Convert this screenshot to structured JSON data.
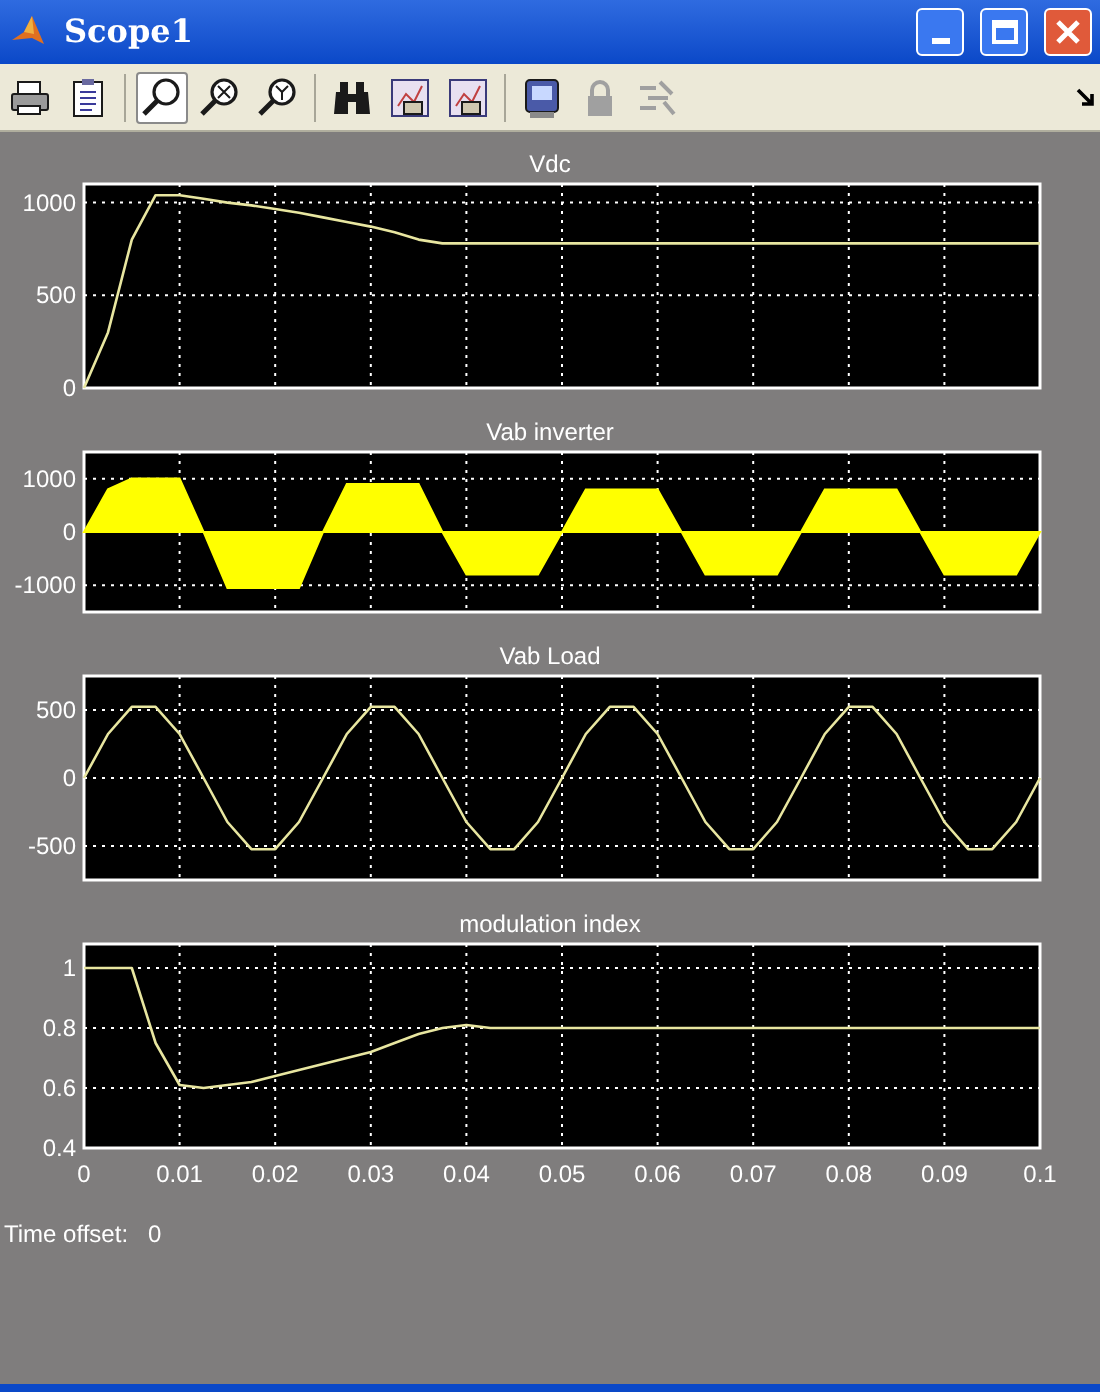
{
  "window": {
    "title": "Scope1"
  },
  "toolbar": [
    {
      "kind": "print",
      "selected": false,
      "disabled": false
    },
    {
      "kind": "parameters",
      "selected": false,
      "disabled": false
    },
    {
      "kind": "zoom",
      "selected": true,
      "disabled": false
    },
    {
      "kind": "zoom-x",
      "selected": false,
      "disabled": false
    },
    {
      "kind": "zoom-y",
      "selected": false,
      "disabled": false
    },
    {
      "kind": "autoscale",
      "selected": false,
      "disabled": false
    },
    {
      "kind": "save-axes",
      "selected": false,
      "disabled": false
    },
    {
      "kind": "restore-axes",
      "selected": false,
      "disabled": false
    },
    {
      "kind": "floating",
      "selected": false,
      "disabled": false
    },
    {
      "kind": "lock",
      "selected": false,
      "disabled": true
    },
    {
      "kind": "signal-select",
      "selected": false,
      "disabled": true
    }
  ],
  "plots": [
    {
      "chart_data": {
        "type": "line",
        "title": "Vdc",
        "grid": true,
        "xlim": [
          0,
          0.1
        ],
        "ylim": [
          0,
          1100
        ],
        "yticks": [
          0,
          500,
          1000
        ],
        "x": [
          0,
          0.0025,
          0.005,
          0.0075,
          0.01,
          0.0125,
          0.015,
          0.0175,
          0.02,
          0.0225,
          0.025,
          0.0275,
          0.03,
          0.0325,
          0.035,
          0.0375,
          0.04,
          0.0425,
          0.045,
          0.0475,
          0.05,
          0.0525,
          0.055,
          0.0575,
          0.06,
          0.0625,
          0.065,
          0.0675,
          0.07,
          0.0725,
          0.075,
          0.0775,
          0.08,
          0.0825,
          0.085,
          0.0875,
          0.09,
          0.0925,
          0.095,
          0.0975,
          0.1
        ],
        "series": [
          {
            "color": "#e8e6a0",
            "values": [
              0,
              300,
              800,
              1040,
              1040,
              1020,
              1000,
              985,
              965,
              945,
              920,
              895,
              870,
              840,
              800,
              780,
              780,
              780,
              780,
              780,
              780,
              780,
              780,
              780,
              780,
              780,
              780,
              780,
              780,
              780,
              780,
              780,
              780,
              780,
              780,
              780,
              780,
              780,
              780,
              780,
              780
            ]
          }
        ]
      }
    },
    {
      "chart_data": {
        "type": "area",
        "title": "Vab inverter",
        "grid": true,
        "xlim": [
          0,
          0.1
        ],
        "ylim": [
          -1500,
          1500
        ],
        "yticks": [
          -1000,
          0,
          1000
        ],
        "x": [
          0,
          0.0025,
          0.005,
          0.0075,
          0.01,
          0.0125,
          0.015,
          0.0175,
          0.02,
          0.0225,
          0.025,
          0.0275,
          0.03,
          0.0325,
          0.035,
          0.0375,
          0.04,
          0.0425,
          0.045,
          0.0475,
          0.05,
          0.0525,
          0.055,
          0.0575,
          0.06,
          0.0625,
          0.065,
          0.0675,
          0.07,
          0.0725,
          0.075,
          0.0775,
          0.08,
          0.0825,
          0.085,
          0.0875,
          0.09,
          0.0925,
          0.095,
          0.0975,
          0.1
        ],
        "series": [
          {
            "color": "#ffff00",
            "values": [
              0,
              800,
              1000,
              1000,
              1000,
              0,
              -1050,
              -1050,
              -1050,
              -1050,
              0,
              900,
              900,
              900,
              900,
              0,
              -800,
              -800,
              -800,
              -800,
              0,
              800,
              800,
              800,
              800,
              0,
              -800,
              -800,
              -800,
              -800,
              0,
              800,
              800,
              800,
              800,
              0,
              -800,
              -800,
              -800,
              -800,
              0
            ]
          }
        ]
      }
    },
    {
      "chart_data": {
        "type": "line",
        "title": "Vab Load",
        "grid": true,
        "xlim": [
          0,
          0.1
        ],
        "ylim": [
          -750,
          750
        ],
        "yticks": [
          -500,
          0,
          500
        ],
        "x": [
          0,
          0.0025,
          0.005,
          0.0075,
          0.01,
          0.0125,
          0.015,
          0.0175,
          0.02,
          0.0225,
          0.025,
          0.0275,
          0.03,
          0.0325,
          0.035,
          0.0375,
          0.04,
          0.0425,
          0.045,
          0.0475,
          0.05,
          0.0525,
          0.055,
          0.0575,
          0.06,
          0.0625,
          0.065,
          0.0675,
          0.07,
          0.0725,
          0.075,
          0.0775,
          0.08,
          0.0825,
          0.085,
          0.0875,
          0.09,
          0.0925,
          0.095,
          0.0975,
          0.1
        ],
        "series": [
          {
            "color": "#e8e6a0",
            "values": [
              0,
              323,
              523,
              523,
              323,
              0,
              -323,
              -523,
              -523,
              -323,
              0,
              323,
              523,
              523,
              323,
              0,
              -323,
              -523,
              -523,
              -323,
              0,
              323,
              523,
              523,
              323,
              0,
              -323,
              -523,
              -523,
              -323,
              0,
              323,
              523,
              523,
              323,
              0,
              -323,
              -523,
              -523,
              -323,
              0
            ]
          }
        ]
      }
    },
    {
      "chart_data": {
        "type": "line",
        "title": "modulation index",
        "grid": true,
        "xlim": [
          0,
          0.1
        ],
        "ylim": [
          0.4,
          1.08
        ],
        "yticks": [
          0.4,
          0.6,
          0.8,
          1
        ],
        "xticks": [
          0,
          0.01,
          0.02,
          0.03,
          0.04,
          0.05,
          0.06,
          0.07,
          0.08,
          0.09,
          0.1
        ],
        "x": [
          0,
          0.0025,
          0.005,
          0.0075,
          0.01,
          0.0125,
          0.015,
          0.0175,
          0.02,
          0.0225,
          0.025,
          0.0275,
          0.03,
          0.0325,
          0.035,
          0.0375,
          0.04,
          0.0425,
          0.045,
          0.0475,
          0.05,
          0.0525,
          0.055,
          0.0575,
          0.06,
          0.0625,
          0.065,
          0.0675,
          0.07,
          0.0725,
          0.075,
          0.0775,
          0.08,
          0.0825,
          0.085,
          0.0875,
          0.09,
          0.0925,
          0.095,
          0.0975,
          0.1
        ],
        "series": [
          {
            "color": "#e8e6a0",
            "values": [
              1,
              1,
              1,
              0.75,
              0.61,
              0.6,
              0.61,
              0.62,
              0.64,
              0.66,
              0.68,
              0.7,
              0.72,
              0.75,
              0.78,
              0.8,
              0.81,
              0.8,
              0.8,
              0.8,
              0.8,
              0.8,
              0.8,
              0.8,
              0.8,
              0.8,
              0.8,
              0.8,
              0.8,
              0.8,
              0.8,
              0.8,
              0.8,
              0.8,
              0.8,
              0.8,
              0.8,
              0.8,
              0.8,
              0.8,
              0.8
            ]
          }
        ]
      }
    }
  ],
  "status": {
    "label": "Time offset:",
    "value": "0"
  }
}
